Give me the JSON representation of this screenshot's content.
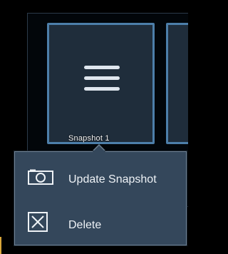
{
  "snapshot": {
    "tile_label": "Snapshot 1",
    "tile_icon": "hamburger-icon"
  },
  "context_menu": {
    "items": [
      {
        "label": "Update Snapshot",
        "icon": "camera-icon"
      },
      {
        "label": "Delete",
        "icon": "close-box-icon"
      }
    ]
  },
  "colors": {
    "tile_bg": "#1f2d3b",
    "tile_border": "#4d7faa",
    "menu_bg": "#34475b",
    "menu_border": "#6f8193",
    "status_text": "#d9a63a"
  }
}
